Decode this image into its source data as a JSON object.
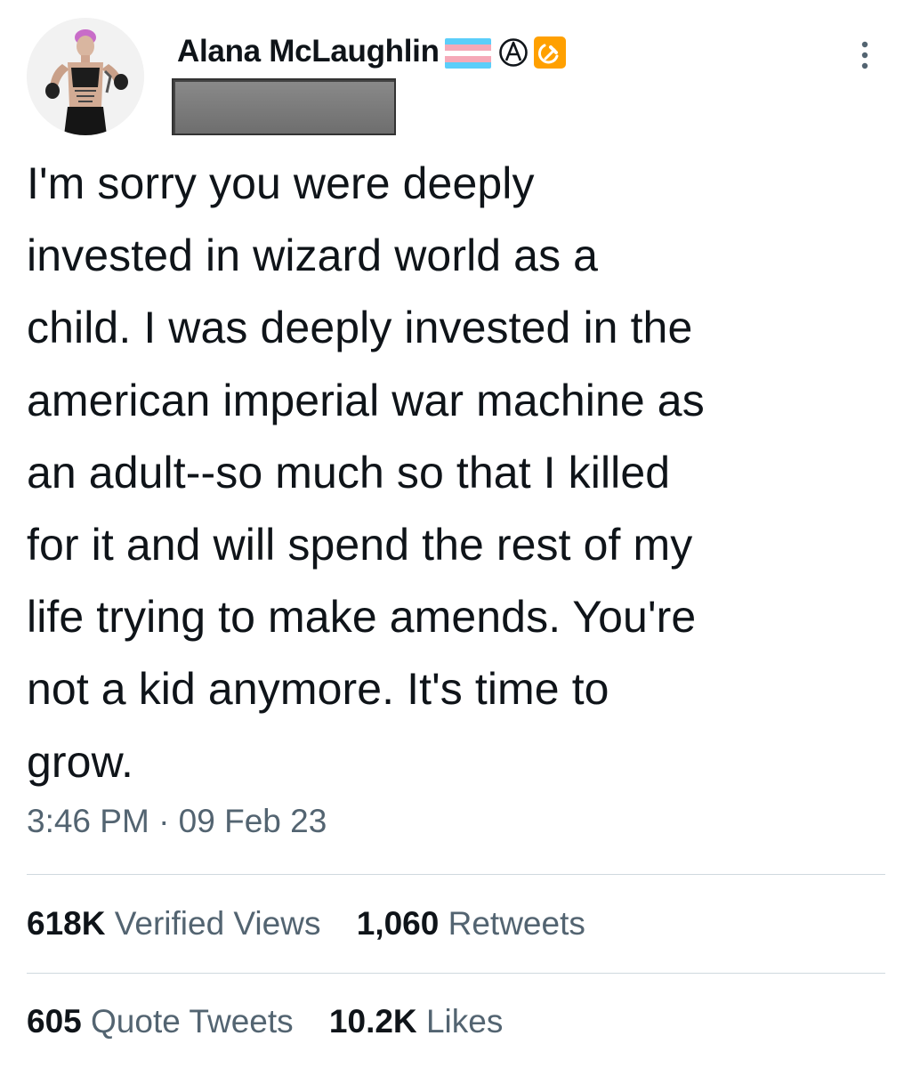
{
  "author": {
    "display_name": "Alana McLaughlin",
    "badges": [
      "transgender-flag-icon",
      "circled-a-anarchy-icon",
      "hammer-and-sickle-icon"
    ],
    "handle_redacted": true
  },
  "tweet": {
    "text_lines": [
      "I'm sorry you were deeply",
      "invested in wizard world as a",
      "child. I was deeply invested in the",
      "american imperial war machine as",
      "an adult--so much so that I killed",
      "for it and will spend the rest of my",
      "life trying to make amends. You're",
      "not a kid anymore. It's time to",
      "grow."
    ],
    "timestamp": "3:46 PM · 09 Feb 23"
  },
  "stats": {
    "views_count": "618K",
    "views_label": "Verified Views",
    "retweets_count": "1,060",
    "retweets_label": "Retweets",
    "quotes_count": "605",
    "quotes_label": "Quote Tweets",
    "likes_count": "10.2K",
    "likes_label": "Likes"
  },
  "colors": {
    "text_primary": "#0f1419",
    "text_secondary": "#536471",
    "divider": "#cfd9de",
    "flag_blue": "#5bcefa",
    "flag_pink": "#f5a9b8",
    "flag_white": "#ffffff",
    "badge_orange": "#ffa000"
  }
}
